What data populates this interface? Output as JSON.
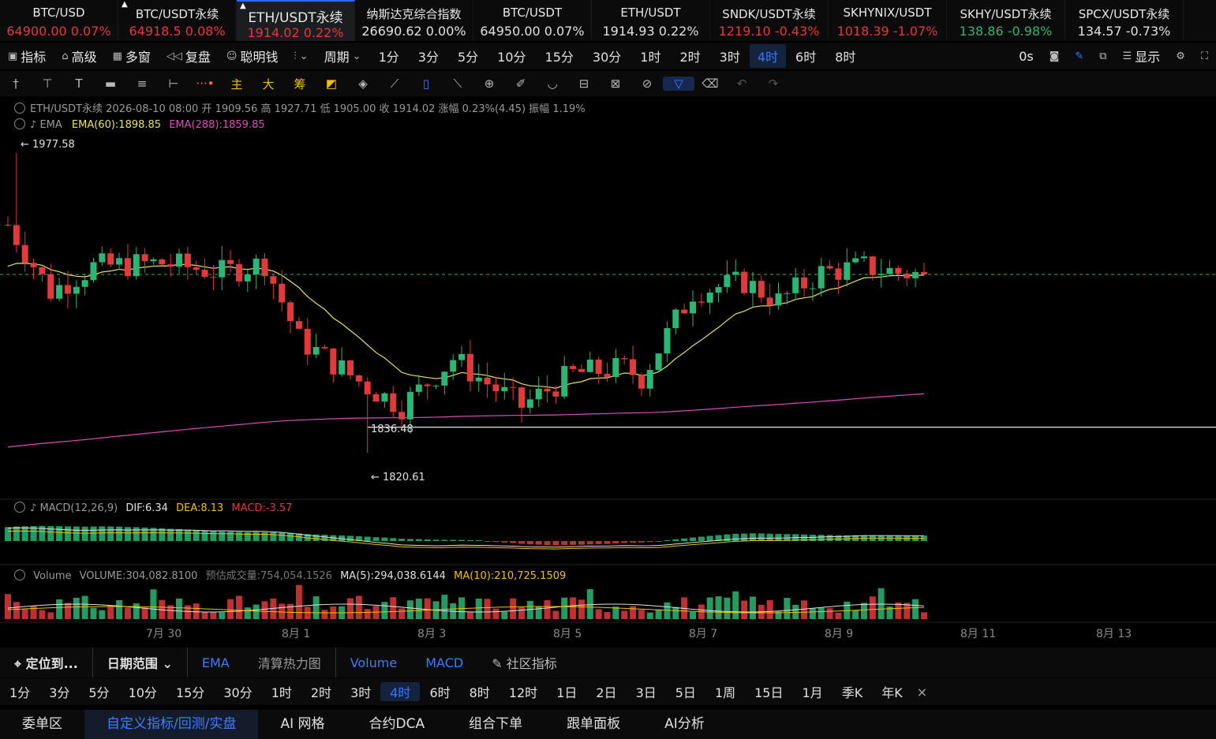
{
  "tickers": [
    {
      "name": "BTC/USD",
      "value": "64900.00 0.07%",
      "color": "#e03a3a",
      "pinned": false
    },
    {
      "name": "BTC/USDT永续",
      "value": "64918.5 0.08%",
      "color": "#e03a3a",
      "pinned": true
    },
    {
      "name": "ETH/USDT永续",
      "value": "1914.02 0.22%",
      "color": "#e03a3a",
      "pinned": true
    },
    {
      "name": "纳斯达克综合指数",
      "value": "26690.62 0.00%",
      "color": "#e0e0e0",
      "pinned": false
    },
    {
      "name": "BTC/USDT",
      "value": "64950.00 0.07%",
      "color": "#e0e0e0",
      "pinned": false
    },
    {
      "name": "ETH/USDT",
      "value": "1914.93 0.22%",
      "color": "#e0e0e0",
      "pinned": false
    },
    {
      "name": "SNDK/USDT永续",
      "value": "1219.10 -0.43%",
      "color": "#e03a3a",
      "pinned": false
    },
    {
      "name": "SKHYNIX/USDT",
      "value": "1018.39 -1.07%",
      "color": "#e03a3a",
      "pinned": false
    },
    {
      "name": "SKHY/USDT永续",
      "value": "138.86 -0.98%",
      "color": "#2bb673",
      "pinned": false
    },
    {
      "name": "SPCX/USDT永续",
      "value": "134.57 -0.73%",
      "color": "#e0e0e0",
      "pinned": false
    }
  ],
  "toolbar1": {
    "indicator": "指标",
    "advanced": "高级",
    "multi_window": "多窗",
    "replay": "复盘",
    "smart_money": "聪明钱",
    "period": "周期",
    "timeframes": [
      "1分",
      "3分",
      "5分",
      "10分",
      "15分",
      "30分",
      "1时",
      "2时",
      "3时",
      "4时",
      "6时",
      "8时"
    ],
    "selected_timeframe": "4时",
    "zero_s": "0s",
    "display": "显示"
  },
  "drawing_tools": [
    "cursor",
    "horizontal-line",
    "text",
    "measure",
    "fib",
    "range",
    "more",
    "主",
    "大",
    "筹",
    "tool-a",
    "tool-b",
    "tool-c",
    "bookmark",
    "ruler",
    "zoom",
    "eraser",
    "magnet",
    "lock",
    "template",
    "link",
    "filter",
    "trash",
    "undo",
    "redo"
  ],
  "legend": {
    "symbol_line": "ETH/USDT永续  2026-08-10 08:00  开 1909.56  高 1927.71  低 1905.00  收 1914.02  涨幅 0.23%(4.45)  振幅 1.19%",
    "ema_name": "EMA",
    "ema60": "EMA(60):1898.85",
    "ema288": "EMA(288):1859.85",
    "macd_name": "MACD(12,26,9)",
    "dif": "DIF:6.34",
    "dea": "DEA:8.13",
    "macd": "MACD:-3.57",
    "vol_name": "Volume",
    "vol_value": "VOLUME:304,082.8100",
    "vol_est": "预估成交量:754,054.1526",
    "ma5": "MA(5):294,038.6144",
    "ma10": "MA(10):210,725.1509"
  },
  "chart_data": {
    "type": "candlestick",
    "high_label": "← 1977.58",
    "low_label": "← 1820.61",
    "hline_label": "1836.48",
    "high": 1977.58,
    "low": 1820.61,
    "hline": 1836.48,
    "current": 1914.02,
    "ylim": [
      1800,
      1990
    ],
    "x_tick_labels": [
      "7月 30",
      "8月 1",
      "8月 3",
      "8月 5",
      "8月 7",
      "8月 9",
      "8月 11",
      "8月 13"
    ],
    "colors": {
      "up": "#2bb673",
      "down": "#e03a3a",
      "ema60": "#e8e06a",
      "ema288": "#d94fb5"
    }
  },
  "indicator_bar": {
    "locate": "定位到...",
    "date_range": "日期范围",
    "ema": "EMA",
    "heatmap": "清算热力图",
    "volume": "Volume",
    "macd": "MACD",
    "community": "社区指标"
  },
  "tf_bar": [
    "1分",
    "3分",
    "5分",
    "10分",
    "15分",
    "30分",
    "1时",
    "2时",
    "3时",
    "4时",
    "6时",
    "8时",
    "12时",
    "1日",
    "2日",
    "3日",
    "5日",
    "1周",
    "15日",
    "1月",
    "季K",
    "年K"
  ],
  "tf_bar_selected": "4时",
  "tabs": [
    "委单区",
    "自定义指标/回测/实盘",
    "AI 网格",
    "合约DCA",
    "组合下单",
    "跟单面板",
    "AI分析"
  ],
  "tabs_selected": "自定义指标/回测/实盘"
}
